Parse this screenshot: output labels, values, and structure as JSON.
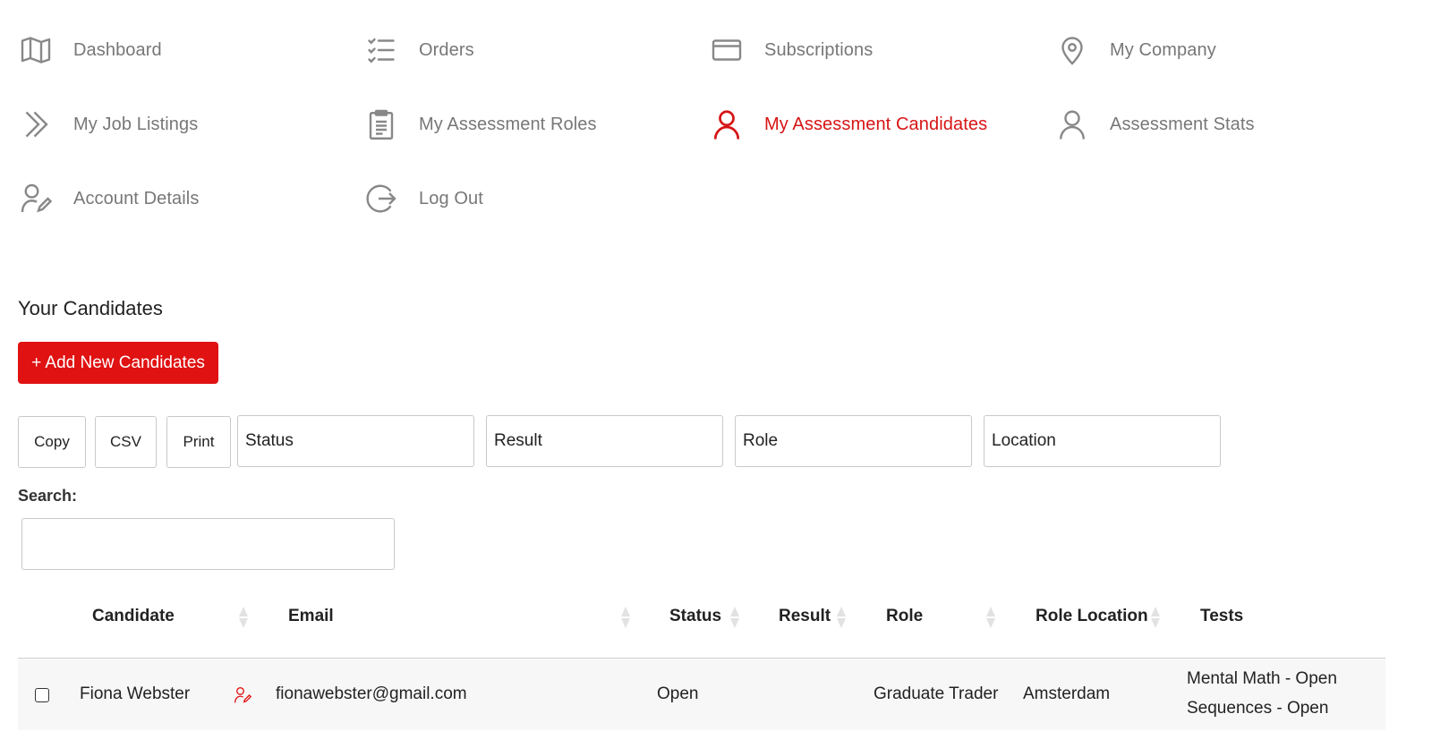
{
  "nav": {
    "items": [
      {
        "label": "Dashboard",
        "icon": "map-icon"
      },
      {
        "label": "Orders",
        "icon": "checklist-icon"
      },
      {
        "label": "Subscriptions",
        "icon": "credit-card-icon"
      },
      {
        "label": "My Company",
        "icon": "map-pin-icon"
      },
      {
        "label": "My Job Listings",
        "icon": "chevrons-right-icon"
      },
      {
        "label": "My Assessment Roles",
        "icon": "clipboard-icon"
      },
      {
        "label": "My Assessment Candidates",
        "icon": "user-icon",
        "active": true
      },
      {
        "label": "Assessment Stats",
        "icon": "user-icon"
      },
      {
        "label": "Account Details",
        "icon": "user-edit-icon"
      },
      {
        "label": "Log Out",
        "icon": "logout-icon"
      }
    ]
  },
  "main": {
    "title": "Your Candidates",
    "add_button": "+ Add New Candidates",
    "tools": {
      "copy": "Copy",
      "csv": "CSV",
      "print": "Print"
    },
    "filters": {
      "status": "Status",
      "result": "Result",
      "role": "Role",
      "location": "Location"
    },
    "search_label": "Search:",
    "search_value": ""
  },
  "table": {
    "headers": [
      "Candidate",
      "Email",
      "Status",
      "Result",
      "Role",
      "Role Location",
      "Tests"
    ],
    "rows": [
      {
        "candidate": "Fiona Webster",
        "email": "fionawebster@gmail.com",
        "status": "Open",
        "result": "",
        "role": "Graduate Trader",
        "location": "Amsterdam",
        "tests": [
          "Mental Math - Open",
          "Sequences - Open"
        ]
      }
    ]
  },
  "colors": {
    "accent": "#e01212",
    "active_nav": "#d71414",
    "nav_text": "#777777"
  }
}
